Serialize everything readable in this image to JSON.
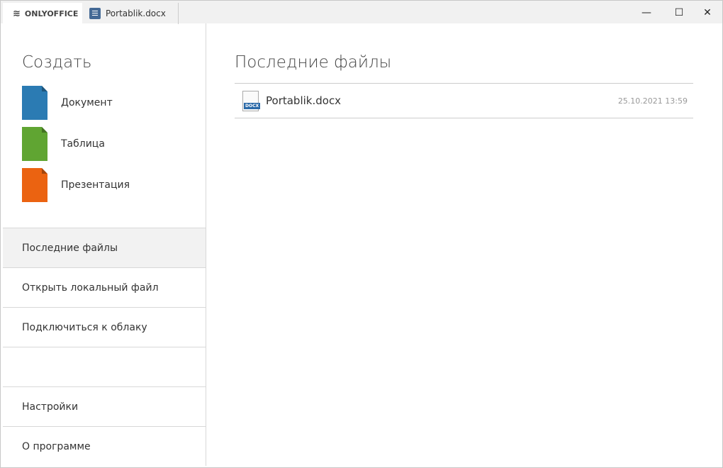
{
  "tabs": {
    "app": "ONLYOFFICE",
    "doc": "Portablik.docx"
  },
  "window": {
    "minimize": "—",
    "maximize": "☐",
    "close": "✕"
  },
  "sidebar": {
    "create_title": "Создать",
    "create": [
      {
        "label": "Документ",
        "color": "#2b7bb3"
      },
      {
        "label": "Таблица",
        "color": "#60a532"
      },
      {
        "label": "Презентация",
        "color": "#eb6311"
      }
    ],
    "nav": [
      "Последние файлы",
      "Открыть локальный файл",
      "Подключиться к облаку",
      "Настройки",
      "О программе"
    ]
  },
  "main": {
    "title": "Последние файлы",
    "files": [
      {
        "name": "Portablik.docx",
        "date": "25.10.2021 13:59",
        "type": "DOCX"
      }
    ]
  }
}
